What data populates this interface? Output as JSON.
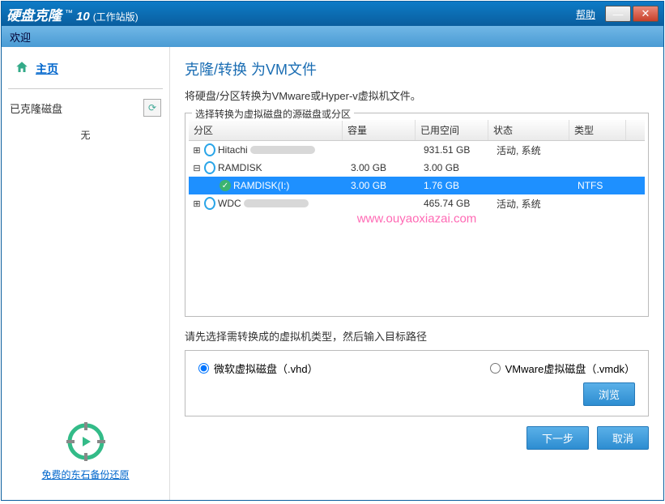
{
  "titlebar": {
    "app_name": "硬盘克隆",
    "tm": "™",
    "version": "10",
    "edition": "(工作站版)",
    "help": "帮助"
  },
  "welcome": "欢迎",
  "sidebar": {
    "home": "主页",
    "cloned_label": "已克隆磁盘",
    "none": "无",
    "footer_link": "免费的东石备份还原"
  },
  "main": {
    "title": "克隆/转换 为VM文件",
    "desc": "将硬盘/分区转换为VMware或Hyper-v虚拟机文件。",
    "group_title": "选择转换为虚拟磁盘的源磁盘或分区",
    "headers": {
      "part": "分区",
      "cap": "容量",
      "used": "已用空间",
      "status": "状态",
      "type": "类型"
    },
    "rows": [
      {
        "kind": "disk",
        "name": "Hitachi",
        "cap": "",
        "used": "931.51 GB",
        "status": "活动, 系统",
        "type": "",
        "expanded": false
      },
      {
        "kind": "disk",
        "name": "RAMDISK",
        "cap": "3.00 GB",
        "used": "3.00 GB",
        "status": "",
        "type": "",
        "expanded": true
      },
      {
        "kind": "part",
        "name": "RAMDISK(I:)",
        "cap": "3.00 GB",
        "used": "1.76 GB",
        "status": "",
        "type": "NTFS",
        "selected": true
      },
      {
        "kind": "disk",
        "name": "WDC",
        "cap": "",
        "used": "465.74 GB",
        "status": "活动, 系统",
        "type": "",
        "expanded": false
      }
    ],
    "watermark": "www.ouyaoxiazai.com",
    "instruction": "请先选择需转换成的虚拟机类型，然后输入目标路径",
    "radio_vhd": "微软虚拟磁盘（.vhd）",
    "radio_vmdk": "VMware虚拟磁盘（.vmdk）",
    "browse": "浏览",
    "next": "下一步",
    "cancel": "取消"
  }
}
